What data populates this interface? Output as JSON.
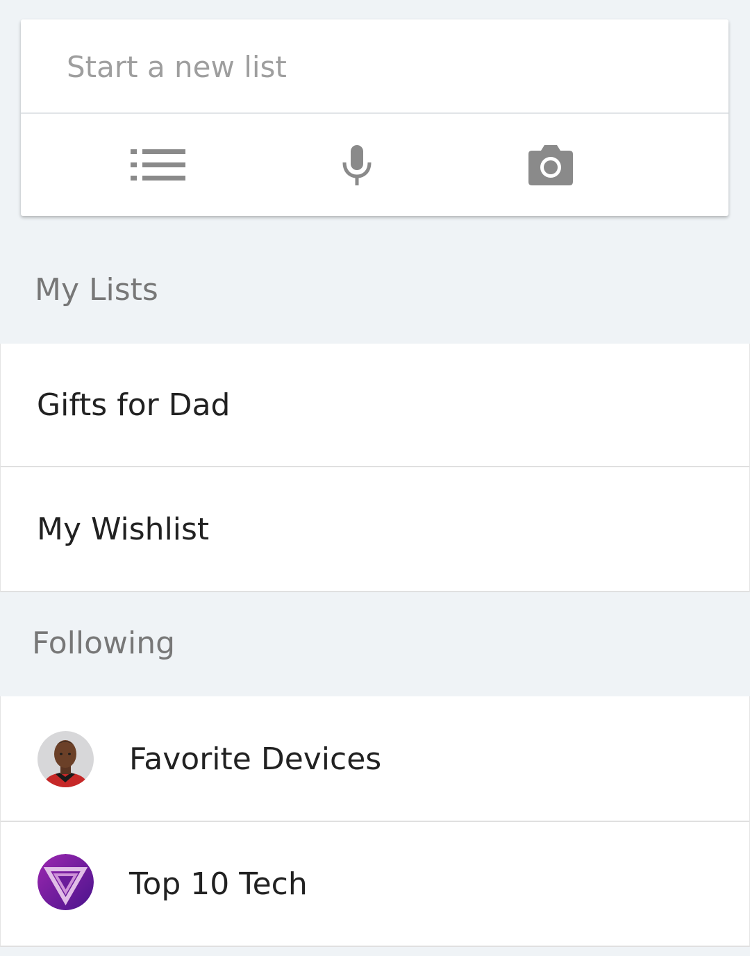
{
  "composer": {
    "placeholder": "Start a new list",
    "actions": [
      {
        "icon": "list-icon"
      },
      {
        "icon": "microphone-icon"
      },
      {
        "icon": "camera-icon"
      }
    ]
  },
  "my_lists": {
    "header": "My Lists",
    "items": [
      {
        "label": "Gifts for Dad"
      },
      {
        "label": "My Wishlist"
      }
    ]
  },
  "following": {
    "header": "Following",
    "items": [
      {
        "label": "Favorite Devices",
        "avatar": "profile-photo"
      },
      {
        "label": "Top 10 Tech",
        "avatar": "purple-triangle-logo"
      }
    ]
  },
  "colors": {
    "background": "#eff3f6",
    "icon_gray": "#8a8a8a",
    "text_primary": "#212121",
    "text_secondary": "#777777",
    "placeholder": "#9e9e9e",
    "logo_purple": "#7b1fa2"
  }
}
